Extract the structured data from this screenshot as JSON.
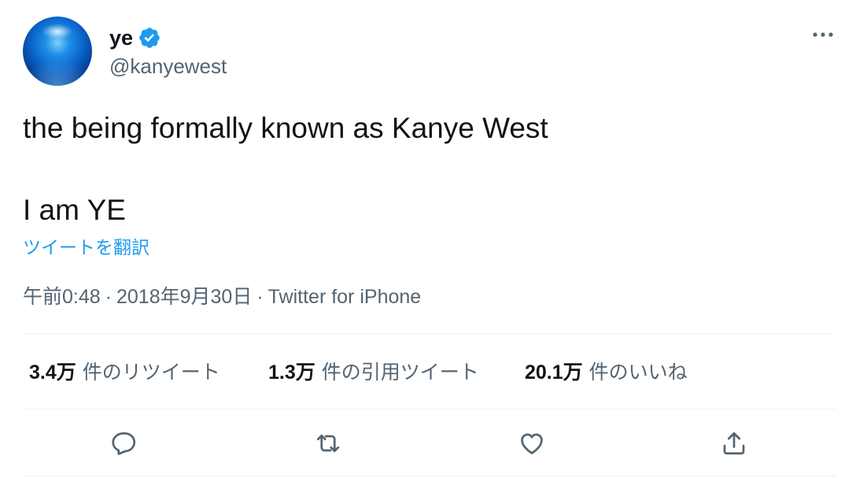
{
  "author": {
    "display_name": "ye",
    "handle": "@kanyewest",
    "verified": true
  },
  "tweet": {
    "line1": "the being formally known as Kanye West",
    "line2": "I am YE",
    "translate_label": "ツイートを翻訳"
  },
  "meta": {
    "time": "午前0:48",
    "separator": "·",
    "date": "2018年9月30日",
    "source": "Twitter for iPhone"
  },
  "stats": [
    {
      "value": "3.4万",
      "label": "件のリツイート"
    },
    {
      "value": "1.3万",
      "label": "件の引用ツイート"
    },
    {
      "value": "20.1万",
      "label": "件のいいね"
    }
  ],
  "actions": [
    "reply-icon",
    "retweet-icon",
    "like-icon",
    "share-icon"
  ],
  "colors": {
    "accent": "#1d9bf0",
    "text": "#0f1419",
    "secondary": "#536471",
    "divider": "#eff3f4"
  }
}
